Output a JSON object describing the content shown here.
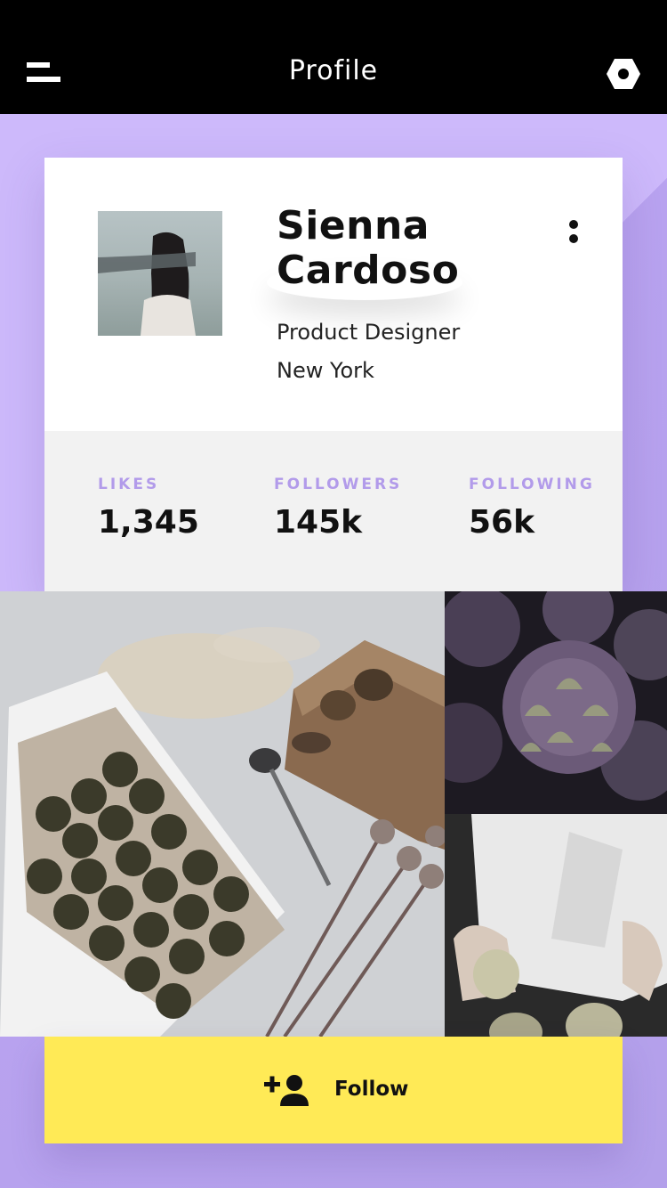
{
  "header": {
    "title": "Profile",
    "menu_icon": "hamburger-menu-icon",
    "settings_icon": "hexagon-settings-icon"
  },
  "profile": {
    "name_first": "Sienna",
    "name_last": "Cardoso",
    "role": "Product Designer",
    "location": "New York",
    "more_icon": "vertical-ellipsis-icon"
  },
  "stats": [
    {
      "label": "LIKES",
      "value": "1,345"
    },
    {
      "label": "FOLLOWERS",
      "value": "145k"
    },
    {
      "label": "FOLLOWING",
      "value": "56k"
    }
  ],
  "gallery": [
    {
      "subject": "plum tart on baking tray"
    },
    {
      "subject": "artichokes"
    },
    {
      "subject": "hands holding pears"
    }
  ],
  "follow": {
    "label": "Follow",
    "icon": "add-person-icon"
  },
  "colors": {
    "background": "#cdb9fb",
    "accent_purple": "#b29bea",
    "follow_button": "#ffea56",
    "topbar": "#000000"
  }
}
